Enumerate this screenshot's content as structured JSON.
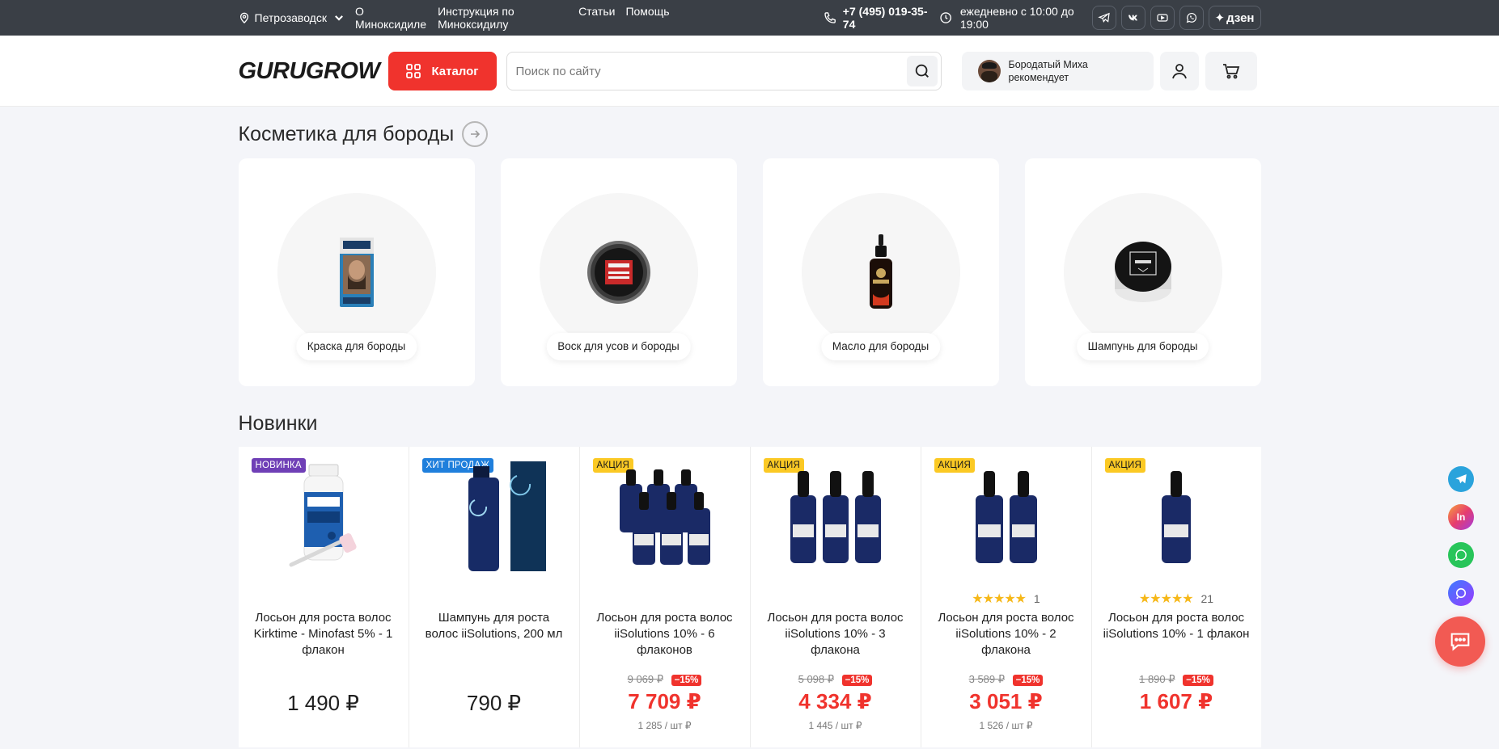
{
  "topbar": {
    "city": "Петрозаводск",
    "links": [
      "О Миноксидиле",
      "Инструкция по Миноксидилу",
      "Статьи",
      "Помощь"
    ],
    "phone": "+7 (495) 019-35-74",
    "hours": "ежедневно с 10:00 до 19:00",
    "socials": [
      "telegram-icon",
      "vk-icon",
      "youtube-icon",
      "whatsapp-icon"
    ],
    "dzen_label": "дзен"
  },
  "header": {
    "logo": "GURUGROW",
    "catalog_label": "Каталог",
    "search_placeholder": "Поиск по сайту",
    "recommend_line1": "Бородатый Миха",
    "recommend_line2": "рекомендует"
  },
  "beard": {
    "title": "Косметика для бороды",
    "categories": [
      {
        "label": "Краска для бороды"
      },
      {
        "label": "Воск для усов и бороды"
      },
      {
        "label": "Масло для бороды"
      },
      {
        "label": "Шампунь для бороды"
      }
    ]
  },
  "new": {
    "title": "Новинки",
    "products": [
      {
        "badge": "НОВИНКА",
        "name": "Лосьон для роста волос Kirktime - Minofast 5% - 1 флакон",
        "price": "1 490 ₽"
      },
      {
        "badge": "ХИТ ПРОДАЖ",
        "name": "Шампунь для роста волос iiSolutions, 200 мл",
        "price": "790 ₽"
      },
      {
        "badge": "АКЦИЯ",
        "name": "Лосьон для роста волос iiSolutions 10% - 6 флаконов",
        "old_price": "9 069 ₽",
        "discount": "−15%",
        "price": "7 709 ₽",
        "unit": "1 285 / шт ₽"
      },
      {
        "badge": "АКЦИЯ",
        "name": "Лосьон для роста волос iiSolutions 10% - 3 флакона",
        "old_price": "5 098 ₽",
        "discount": "−15%",
        "price": "4 334 ₽",
        "unit": "1 445 / шт ₽"
      },
      {
        "badge": "АКЦИЯ",
        "stars": "★★★★★",
        "reviews": "1",
        "name": "Лосьон для роста волос iiSolutions 10% - 2 флакона",
        "old_price": "3 589 ₽",
        "discount": "−15%",
        "price": "3 051 ₽",
        "unit": "1 526 / шт ₽"
      },
      {
        "badge": "АКЦИЯ",
        "stars": "★★★★★",
        "reviews": "21",
        "name": "Лосьон для роста волос iiSolutions 10% - 1 флакон",
        "old_price": "1 890 ₽",
        "discount": "−15%",
        "price": "1 607 ₽"
      }
    ]
  },
  "floating": {
    "instagram_label": "In"
  },
  "colors": {
    "accent": "#f0332d",
    "topbar": "#3a3f46",
    "badge_new": "#6f3fb6",
    "badge_hit": "#1f7fdc",
    "badge_sale": "#fbc924",
    "stars": "#f6b819"
  }
}
